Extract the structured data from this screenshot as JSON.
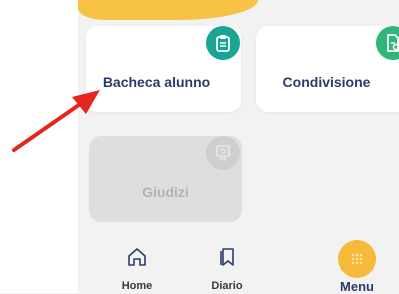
{
  "cards": {
    "bacheca": {
      "label": "Bacheca alunno",
      "icon": "clipboard-icon"
    },
    "condivisione": {
      "label": "Condivisione",
      "icon": "share-document-icon"
    },
    "giudizi": {
      "label": "Giudizi",
      "icon": "certificate-icon",
      "disabled": true
    }
  },
  "nav": {
    "home": {
      "label": "Home",
      "icon": "home-icon"
    },
    "diario": {
      "label": "Diario",
      "icon": "bookmark-icon"
    },
    "menu": {
      "label": "Menu",
      "icon": "grid-dots-icon",
      "active": true
    }
  },
  "annotation": {
    "icon": "red-arrow-icon"
  },
  "colors": {
    "accent": "#f7b93a",
    "teal": "#1aa493",
    "green": "#31b67a",
    "navy_text": "#2c3c6a",
    "arrow": "#e52521"
  }
}
